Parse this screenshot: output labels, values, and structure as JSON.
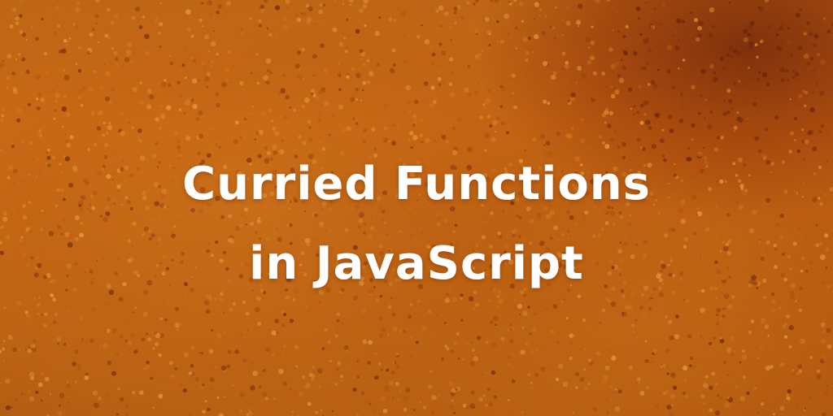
{
  "title": {
    "line1": "Curried Functions",
    "line2": "in JavaScript",
    "color": "#ffffff"
  },
  "background": {
    "subject": "orange spice powder close-up",
    "base_color": "#c96a15",
    "dark_accent": "#7a2d0a"
  }
}
